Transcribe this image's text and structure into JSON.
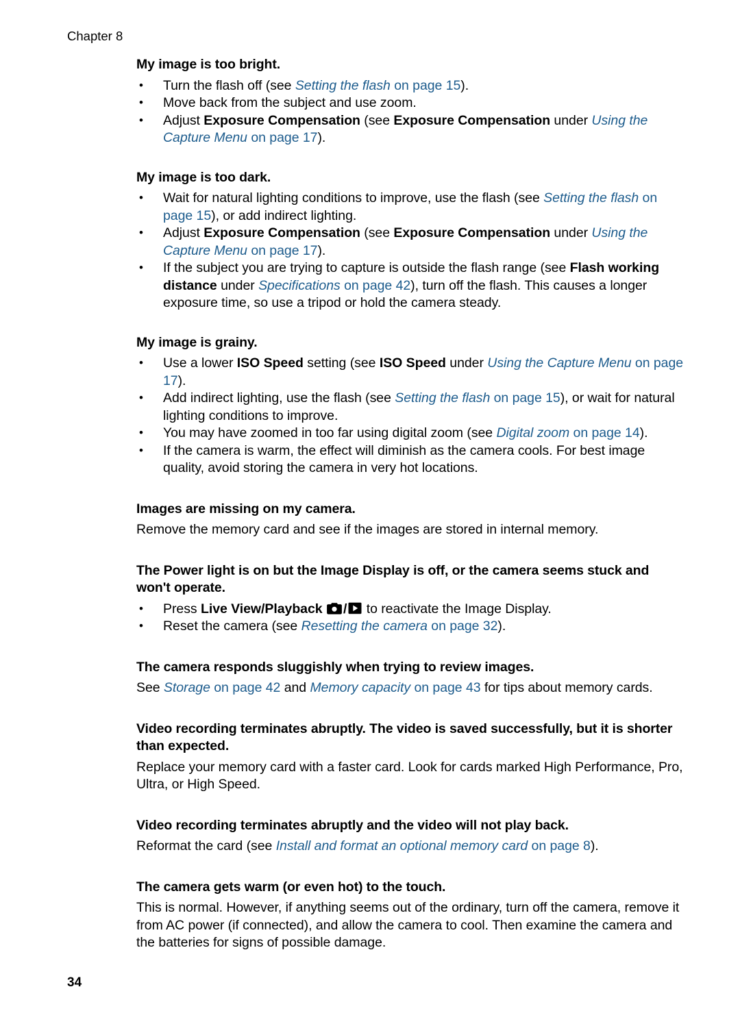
{
  "page": {
    "chapter_label": "Chapter 8",
    "page_number": "34",
    "link_color": "#1d5c8d",
    "text_color": "#000000",
    "background_color": "#ffffff"
  },
  "sections": {
    "too_bright": {
      "heading": "My image is too bright.",
      "b1_a": "Turn the flash off (see ",
      "b1_link": "Setting the flash",
      "b1_b": " on page 15",
      "b1_c": ").",
      "b2": "Move back from the subject and use zoom.",
      "b3_a": "Adjust ",
      "b3_bold1": "Exposure Compensation",
      "b3_b": " (see ",
      "b3_bold2": "Exposure Compensation",
      "b3_c": " under ",
      "b3_link": "Using the Capture Menu",
      "b3_d": " on page 17",
      "b3_e": ")."
    },
    "too_dark": {
      "heading": "My image is too dark.",
      "b1_a": "Wait for natural lighting conditions to improve, use the flash (see ",
      "b1_link": "Setting the flash",
      "b1_b": " on page 15",
      "b1_c": "), or add indirect lighting.",
      "b2_a": "Adjust ",
      "b2_bold1": "Exposure Compensation",
      "b2_b": " (see ",
      "b2_bold2": "Exposure Compensation",
      "b2_c": " under ",
      "b2_link": "Using the Capture Menu",
      "b2_d": " on page 17",
      "b2_e": ").",
      "b3_a": "If the subject you are trying to capture is outside the flash range (see ",
      "b3_bold": "Flash working distance",
      "b3_b": " under ",
      "b3_link": "Specifications",
      "b3_c": " on page 42",
      "b3_d": "), turn off the flash. This causes a longer exposure time, so use a tripod or hold the camera steady."
    },
    "grainy": {
      "heading": "My image is grainy.",
      "b1_a": "Use a lower ",
      "b1_bold1": "ISO Speed",
      "b1_b": " setting (see ",
      "b1_bold2": "ISO Speed",
      "b1_c": " under ",
      "b1_link": "Using the Capture Menu",
      "b1_d": " on page 17",
      "b1_e": ").",
      "b2_a": "Add indirect lighting, use the flash (see ",
      "b2_link": "Setting the flash",
      "b2_b": " on page 15",
      "b2_c": "), or wait for natural lighting conditions to improve.",
      "b3_a": "You may have zoomed in too far using digital zoom (see ",
      "b3_link": "Digital zoom",
      "b3_b": " on page 14",
      "b3_c": ").",
      "b4": "If the camera is warm, the effect will diminish as the camera cools. For best image quality, avoid storing the camera in very hot locations."
    },
    "images_missing": {
      "heading": "Images are missing on my camera.",
      "body": "Remove the memory card and see if the images are stored in internal memory."
    },
    "power_light": {
      "heading": "The Power light is on but the Image Display is off, or the camera seems stuck and won't operate.",
      "b1_a": "Press ",
      "b1_bold": "Live View/Playback",
      "b1_icon1": "camera-icon",
      "b1_slash": "/",
      "b1_icon2": "playback-icon",
      "b1_b": " to reactivate the Image Display.",
      "b2_a": "Reset the camera (see ",
      "b2_link": "Resetting the camera",
      "b2_b": " on page 32",
      "b2_c": ")."
    },
    "sluggish": {
      "heading": "The camera responds sluggishly when trying to review images.",
      "body_a": "See ",
      "body_link1": "Storage",
      "body_b": " on page 42",
      "body_c": " and ",
      "body_link2": "Memory capacity",
      "body_d": " on page 43",
      "body_e": " for tips about memory cards."
    },
    "video_short": {
      "heading": "Video recording terminates abruptly. The video is saved successfully, but it is shorter than expected.",
      "body": "Replace your memory card with a faster card. Look for cards marked High Performance, Pro, Ultra, or High Speed."
    },
    "video_no_play": {
      "heading": "Video recording terminates abruptly and the video will not play back.",
      "body_a": "Reformat the card (see ",
      "body_link": "Install and format an optional memory card",
      "body_b": " on page 8",
      "body_c": ")."
    },
    "camera_warm": {
      "heading": "The camera gets warm (or even hot) to the touch.",
      "body": "This is normal. However, if anything seems out of the ordinary, turn off the camera, remove it from AC power (if connected), and allow the camera to cool. Then examine the camera and the batteries for signs of possible damage."
    }
  }
}
